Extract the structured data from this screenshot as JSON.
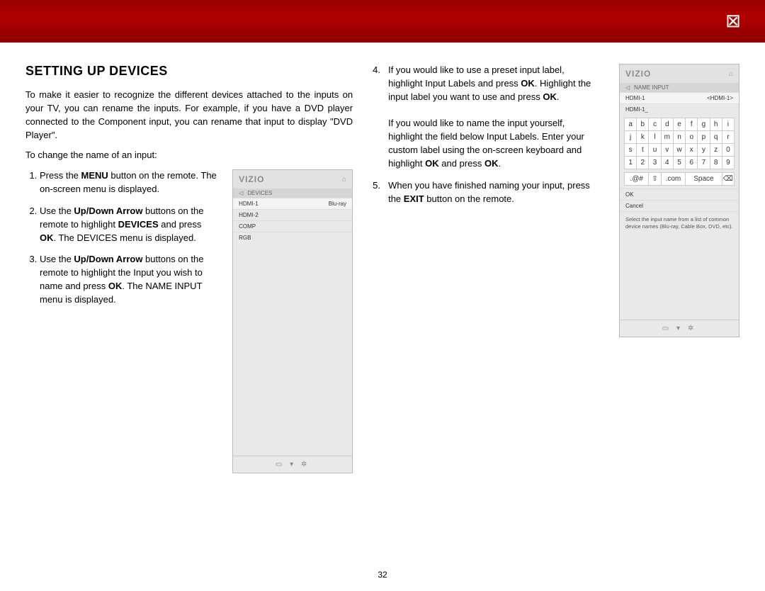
{
  "chapter_icon": "⊠",
  "title": "SETTING UP DEVICES",
  "intro": "To make it easier to recognize the different devices attached to the inputs on your TV, you can rename the inputs. For example, if you have a DVD player connected to the Component input, you can rename that input to display \"DVD Player\".",
  "lead": "To change the name of an input:",
  "steps": {
    "s1_a": "Press the ",
    "s1_menu": "MENU",
    "s1_b": " button on the remote. The on-screen menu is displayed.",
    "s2_a": "Use the ",
    "s2_up": "Up/Down Arrow",
    "s2_b": " buttons on the remote to highlight ",
    "s2_dev": "DEVICES",
    "s2_c": " and press ",
    "s2_ok": "OK",
    "s2_d": ". The DEVICES menu is displayed.",
    "s3_a": "Use the ",
    "s3_up": "Up/Down Arrow",
    "s3_b": " buttons on the remote to highlight the Input you wish to name and press ",
    "s3_ok": "OK",
    "s3_c": ". The NAME INPUT menu is displayed.",
    "s4_a": "If you would like to use a preset input label, highlight Input Labels and press ",
    "s4_ok1": "OK",
    "s4_b": ". Highlight the input label you want to use and press ",
    "s4_ok2": "OK",
    "s4_c": ".",
    "s4_p2_a": "If you would like to name the input yourself, highlight the field below Input Labels. Enter your custom label using the on-screen keyboard and highlight ",
    "s4_p2_ok1": "OK",
    "s4_p2_b": " and press ",
    "s4_p2_ok2": "OK",
    "s4_p2_c": ".",
    "s5_a": "When you have finished naming your input, press the ",
    "s5_exit": "EXIT",
    "s5_b": " button on the remote."
  },
  "osd1": {
    "brand": "VIZIO",
    "nav": "DEVICES",
    "rows": [
      {
        "l": "HDMI-1",
        "r": "Blu-ray"
      },
      {
        "l": "HDMI-2",
        "r": ""
      },
      {
        "l": "COMP",
        "r": ""
      },
      {
        "l": "RGB",
        "r": ""
      }
    ],
    "footer": "▭  ▾  ✲"
  },
  "osd2": {
    "brand": "VIZIO",
    "nav": "NAME INPUT",
    "row1": {
      "l": "HDMI-1",
      "r": "<HDMI-1>"
    },
    "row2": {
      "l": "HDMI-1_",
      "r": ""
    },
    "keys_alpha": [
      "a",
      "b",
      "c",
      "d",
      "e",
      "f",
      "g",
      "h",
      "i",
      "j",
      "k",
      "l",
      "m",
      "n",
      "o",
      "p",
      "q",
      "r",
      "s",
      "t",
      "u",
      "v",
      "w",
      "x",
      "y",
      "z",
      "0",
      "1",
      "2",
      "3",
      "4",
      "5",
      "6",
      "7",
      "8",
      "9"
    ],
    "keys_bottom": [
      ".@#",
      "⇧",
      ".com",
      "Space",
      "⌫"
    ],
    "ok": "OK",
    "cancel": "Cancel",
    "hint": "Select the input name from a list of common device names (Blu-ray, Cable Box, DVD, etc).",
    "footer": "▭  ▾  ✲"
  },
  "page_number": "32"
}
